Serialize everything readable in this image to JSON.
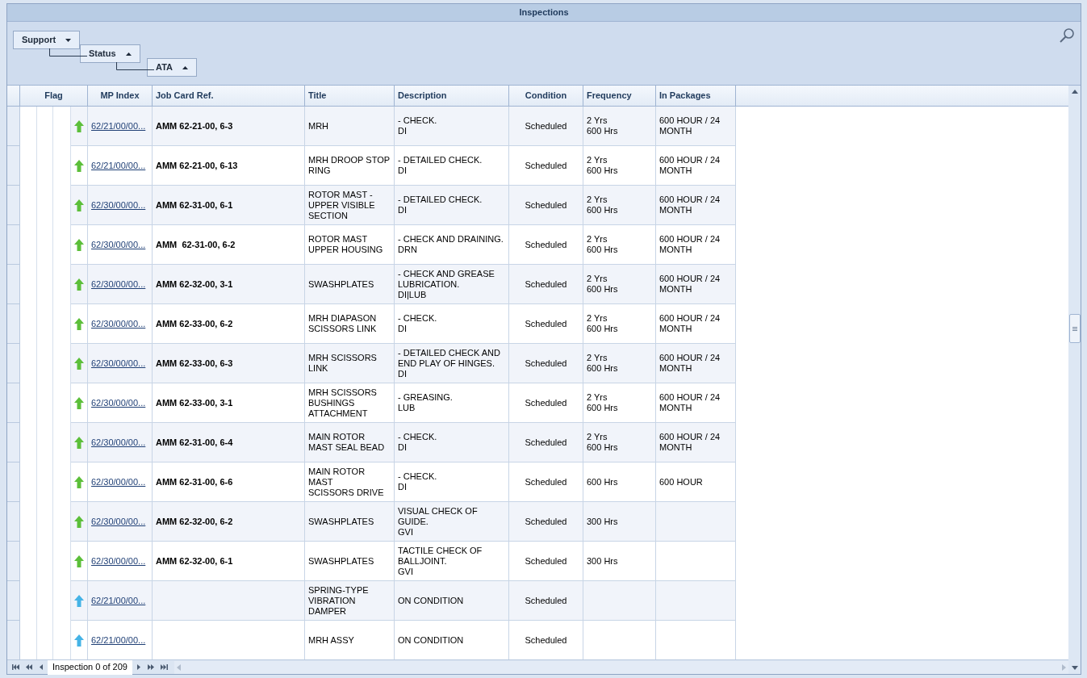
{
  "window": {
    "title": "Inspections"
  },
  "group_by": [
    {
      "label": "Support",
      "ascending": false
    },
    {
      "label": "Status",
      "ascending": true
    },
    {
      "label": "ATA",
      "ascending": true
    }
  ],
  "table": {
    "columns": [
      "Flag",
      "MP Index",
      "Job Card Ref.",
      "Title",
      "Description",
      "Condition",
      "Frequency",
      "In Packages"
    ],
    "rows": [
      {
        "color": "#5cbf3a",
        "mp_index": "62/21/00/00...",
        "job_card": "AMM 62-21-00, 6-3",
        "title": "MRH",
        "description": "- CHECK.\nDI",
        "condition": "Scheduled",
        "frequency": "2 Yrs\n600 Hrs",
        "packages": "600 HOUR / 24 MONTH"
      },
      {
        "color": "#5cbf3a",
        "mp_index": "62/21/00/00...",
        "job_card": "AMM 62-21-00, 6-13",
        "title": "MRH DROOP STOP RING",
        "description": "- DETAILED CHECK.\nDI",
        "condition": "Scheduled",
        "frequency": "2 Yrs\n600 Hrs",
        "packages": "600 HOUR / 24 MONTH"
      },
      {
        "color": "#5cbf3a",
        "mp_index": "62/30/00/00...",
        "job_card": "AMM 62-31-00, 6-1",
        "title": "ROTOR MAST - UPPER VISIBLE SECTION",
        "description": "- DETAILED CHECK.\nDI",
        "condition": "Scheduled",
        "frequency": "2 Yrs\n600 Hrs",
        "packages": "600 HOUR / 24 MONTH"
      },
      {
        "color": "#5cbf3a",
        "mp_index": "62/30/00/00...",
        "job_card": "AMM  62-31-00, 6-2",
        "title": "ROTOR MAST UPPER HOUSING",
        "description": "- CHECK AND DRAINING.\nDRN",
        "condition": "Scheduled",
        "frequency": "2 Yrs\n600 Hrs",
        "packages": "600 HOUR / 24 MONTH"
      },
      {
        "color": "#5cbf3a",
        "mp_index": "62/30/00/00...",
        "job_card": "AMM 62-32-00, 3-1",
        "title": "SWASHPLATES",
        "description": "- CHECK AND GREASE LUBRICATION.\nDI|LUB",
        "condition": "Scheduled",
        "frequency": "2 Yrs\n600 Hrs",
        "packages": "600 HOUR / 24 MONTH"
      },
      {
        "color": "#5cbf3a",
        "mp_index": "62/30/00/00...",
        "job_card": "AMM 62-33-00, 6-2",
        "title": "MRH DIAPASON SCISSORS LINK",
        "description": "- CHECK.\nDI",
        "condition": "Scheduled",
        "frequency": "2 Yrs\n600 Hrs",
        "packages": "600 HOUR / 24 MONTH"
      },
      {
        "color": "#5cbf3a",
        "mp_index": "62/30/00/00...",
        "job_card": "AMM 62-33-00, 6-3",
        "title": "MRH SCISSORS LINK",
        "description": "- DETAILED CHECK AND END PLAY OF HINGES.\nDI",
        "condition": "Scheduled",
        "frequency": "2 Yrs\n600 Hrs",
        "packages": "600 HOUR / 24 MONTH"
      },
      {
        "color": "#5cbf3a",
        "mp_index": "62/30/00/00...",
        "job_card": "AMM 62-33-00, 3-1",
        "title": "MRH SCISSORS BUSHINGS ATTACHMENT",
        "description": "- GREASING.\nLUB",
        "condition": "Scheduled",
        "frequency": "2 Yrs\n600 Hrs",
        "packages": "600 HOUR / 24 MONTH"
      },
      {
        "color": "#5cbf3a",
        "mp_index": "62/30/00/00...",
        "job_card": "AMM 62-31-00, 6-4",
        "title": "MAIN ROTOR MAST SEAL BEAD",
        "description": "- CHECK.\nDI",
        "condition": "Scheduled",
        "frequency": "2 Yrs\n600 Hrs",
        "packages": "600 HOUR / 24 MONTH"
      },
      {
        "color": "#5cbf3a",
        "mp_index": "62/30/00/00...",
        "job_card": "AMM 62-31-00, 6-6",
        "title": " MAIN ROTOR\nMAST\nSCISSORS DRIVE",
        "description": "- CHECK.\nDI",
        "condition": "Scheduled",
        "frequency": "600 Hrs",
        "packages": "600 HOUR"
      },
      {
        "color": "#5cbf3a",
        "mp_index": "62/30/00/00...",
        "job_card": "AMM 62-32-00, 6-2",
        "title": "SWASHPLATES",
        "description": "VISUAL CHECK OF GUIDE.\nGVI",
        "condition": "Scheduled",
        "frequency": "300 Hrs"
      },
      {
        "color": "#5cbf3a",
        "mp_index": "62/30/00/00...",
        "job_card": "AMM 62-32-00, 6-1",
        "title": "SWASHPLATES",
        "description": "TACTILE CHECK OF BALLJOINT.\nGVI",
        "condition": "Scheduled",
        "frequency": "300 Hrs"
      },
      {
        "color": "#45b3e6",
        "mp_index": "62/21/00/00...",
        "title": "SPRING-TYPE VIBRATION DAMPER",
        "description": "ON CONDITION",
        "condition": "Scheduled"
      },
      {
        "color": "#45b3e6",
        "mp_index": "62/21/00/00...",
        "title": "MRH ASSY",
        "description": "ON CONDITION",
        "condition": "Scheduled"
      }
    ]
  },
  "pager": {
    "label": "Inspection 0 of 209"
  }
}
